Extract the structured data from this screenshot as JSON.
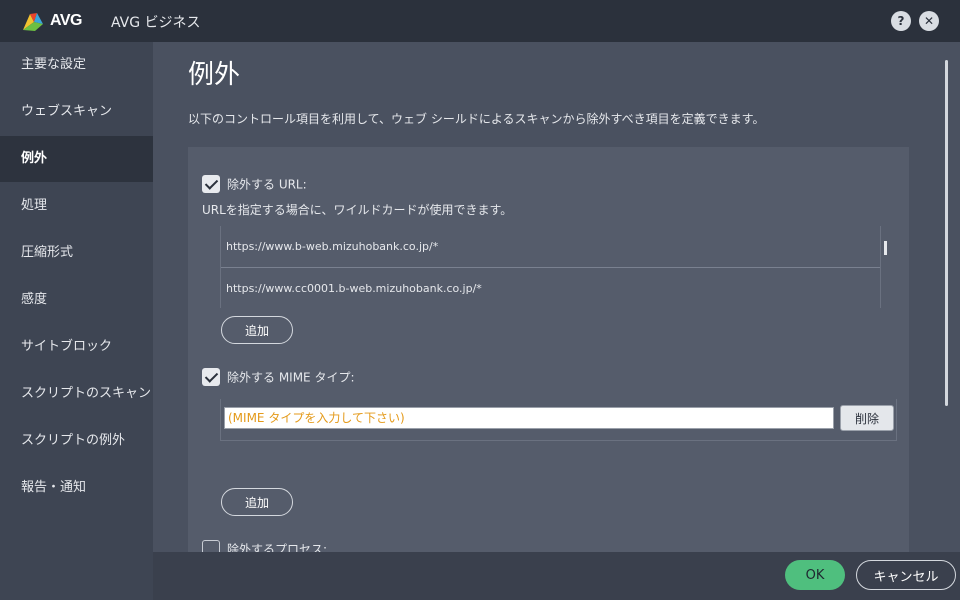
{
  "titlebar": {
    "brand": "AVG",
    "title": "AVG ビジネス",
    "help_icon": "?",
    "close_icon": "✕"
  },
  "sidebar": {
    "items": [
      {
        "label": "主要な設定"
      },
      {
        "label": "ウェブスキャン"
      },
      {
        "label": "例外",
        "active": true
      },
      {
        "label": "処理"
      },
      {
        "label": "圧縮形式"
      },
      {
        "label": "感度"
      },
      {
        "label": "サイトブロック"
      },
      {
        "label": "スクリプトのスキャン"
      },
      {
        "label": "スクリプトの例外"
      },
      {
        "label": "報告・通知"
      }
    ]
  },
  "main": {
    "title": "例外",
    "description": "以下のコントロール項目を利用して、ウェブ シールドによるスキャンから除外すべき項目を定義できます。",
    "url_section": {
      "label": "除外する URL:",
      "checked": true,
      "hint": "URLを指定する場合に、ワイルドカードが使用できます。",
      "urls": [
        "https://www.b-web.mizuhobank.co.jp/*",
        "https://www.cc0001.b-web.mizuhobank.co.jp/*"
      ],
      "add_label": "追加"
    },
    "mime_section": {
      "label": "除外する MIME タイプ:",
      "checked": true,
      "placeholder": "(MIME タイプを入力して下さい)",
      "delete_label": "削除",
      "add_label": "追加"
    },
    "process_section": {
      "label": "除外するプロセス:",
      "checked": false
    }
  },
  "footer": {
    "ok_label": "OK",
    "cancel_label": "キャンセル"
  },
  "colors": {
    "ok_green": "#4fbf7e",
    "placeholder_orange": "#e49a1a",
    "sidebar_bg": "#3e4553",
    "main_bg": "#4a5160"
  }
}
